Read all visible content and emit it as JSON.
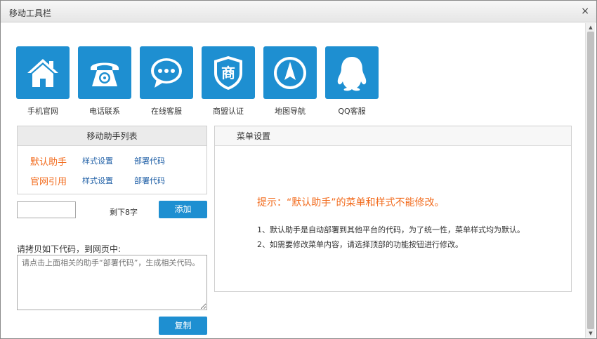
{
  "window": {
    "title": "移动工具栏",
    "close_label": "×"
  },
  "icons": [
    {
      "label": "手机官网",
      "icon": "home-icon"
    },
    {
      "label": "电话联系",
      "icon": "telephone-icon"
    },
    {
      "label": "在线客服",
      "icon": "chat-bubble-icon"
    },
    {
      "label": "商盟认证",
      "icon": "shield-icon",
      "glyph": "商"
    },
    {
      "label": "地图导航",
      "icon": "compass-icon"
    },
    {
      "label": "QQ客服",
      "icon": "qq-penguin-icon"
    }
  ],
  "assistant_list": {
    "title": "移动助手列表",
    "items": [
      {
        "name": "默认助手",
        "style_link": "样式设置",
        "deploy_link": "部署代码"
      },
      {
        "name": "官网引用",
        "style_link": "样式设置",
        "deploy_link": "部署代码"
      }
    ]
  },
  "add_form": {
    "input_value": "",
    "remaining": "剩下8字",
    "add_label": "添加"
  },
  "code": {
    "label": "请拷贝如下代码，到网页中:",
    "placeholder": "请点击上面相关的助手“部署代码”，生成相关代码。",
    "copy_label": "复制"
  },
  "menu_settings": {
    "title": "菜单设置",
    "tip": "提示：“默认助手”的菜单和样式不能修改。",
    "notes": [
      "1、默认助手是自动部署到其他平台的代码，为了统一性，菜单样式均为默认。",
      "2、如需要修改菜单内容，请选择顶部的功能按钮进行修改。"
    ]
  },
  "colors": {
    "accent_blue": "#1e8fd1",
    "highlight_orange": "#f26b1d",
    "link_blue": "#1f5fa6"
  }
}
